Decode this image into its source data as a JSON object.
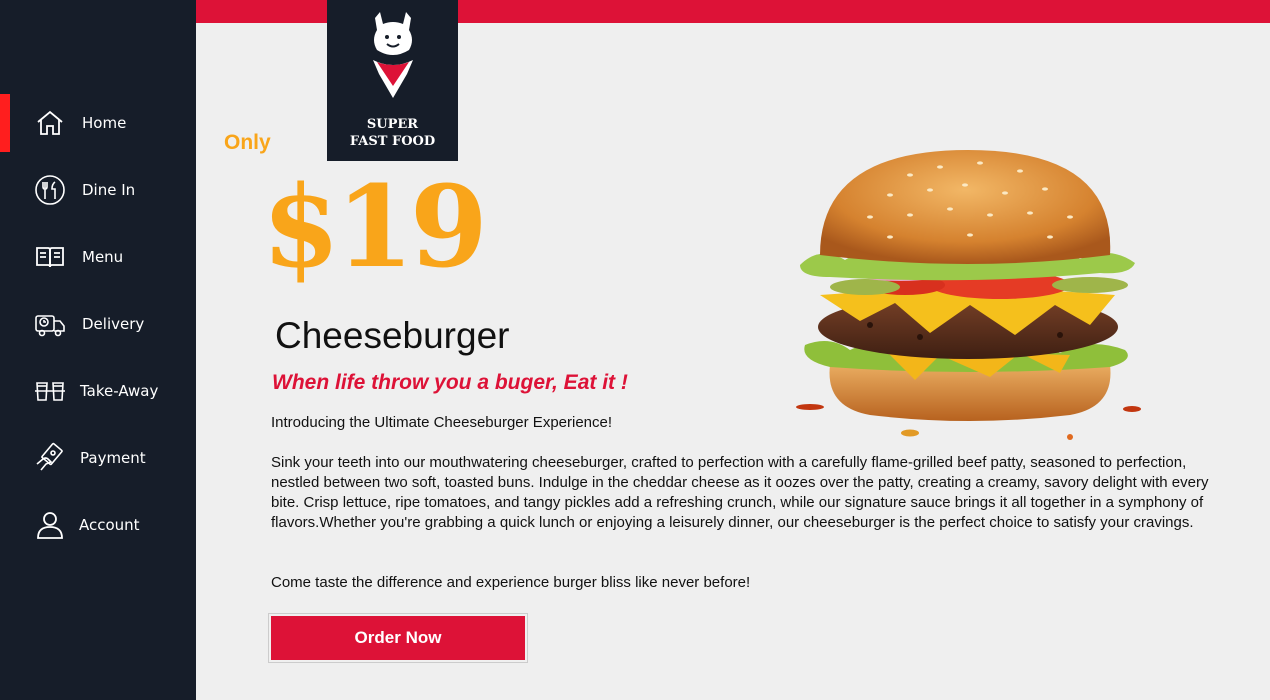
{
  "sidebar": {
    "items": [
      {
        "label": "Home",
        "icon": "home-icon",
        "active": true
      },
      {
        "label": "Dine In",
        "icon": "dine-in-icon",
        "active": false
      },
      {
        "label": "Menu",
        "icon": "menu-book-icon",
        "active": false
      },
      {
        "label": "Delivery",
        "icon": "delivery-truck-icon",
        "active": false
      },
      {
        "label": "Take-Away",
        "icon": "take-away-icon",
        "active": false
      },
      {
        "label": "Payment",
        "icon": "payment-icon",
        "active": false
      },
      {
        "label": "Account",
        "icon": "account-icon",
        "active": false
      }
    ]
  },
  "logo": {
    "line1": "SUPER",
    "line2": "FAST FOOD"
  },
  "hero": {
    "only": "Only",
    "price": "$19",
    "title": "Cheeseburger",
    "tagline": "When life throw you a buger, Eat it !",
    "intro": "Introducing the Ultimate Cheeseburger Experience!",
    "body": "Sink your teeth into our mouthwatering cheeseburger, crafted to perfection with a carefully flame-grilled beef patty, seasoned to perfection, nestled between two soft, toasted buns. Indulge in the cheddar cheese as it oozes over the patty, creating a creamy, savory delight with every bite. Crisp lettuce, ripe tomatoes, and tangy pickles add a refreshing crunch, while our signature sauce brings it all together in a symphony of flavors.Whether you're grabbing a quick lunch or enjoying a leisurely dinner, our cheeseburger is the perfect choice to satisfy your cravings.",
    "closing": "Come taste the difference and experience burger bliss like never before!",
    "order_label": "Order Now"
  },
  "colors": {
    "accent_red": "#dd1237",
    "price_orange": "#f9a51a",
    "sidebar_bg": "#161d29",
    "active_indicator": "#ff1e1e"
  }
}
